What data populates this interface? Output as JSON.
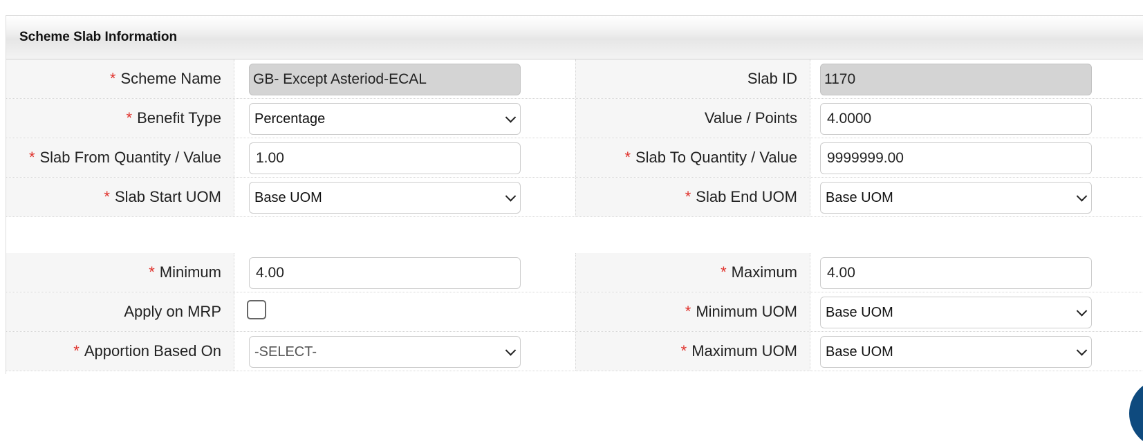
{
  "panel": {
    "title": "Scheme Slab Information"
  },
  "section1": {
    "rows": [
      {
        "left": {
          "label": "Scheme Name",
          "required": true,
          "type": "readonly",
          "value": "GB- Except Asteriod-ECAL"
        },
        "right": {
          "label": "Slab ID",
          "required": false,
          "type": "readonly",
          "value": "1170"
        }
      },
      {
        "left": {
          "label": "Benefit Type",
          "required": true,
          "type": "select",
          "value": "Percentage"
        },
        "right": {
          "label": "Value / Points",
          "required": false,
          "type": "input",
          "value": "4.0000"
        }
      },
      {
        "left": {
          "label": "Slab From Quantity / Value",
          "required": true,
          "type": "input",
          "value": "1.00"
        },
        "right": {
          "label": "Slab To Quantity / Value",
          "required": true,
          "type": "input",
          "value": "9999999.00"
        }
      },
      {
        "left": {
          "label": "Slab Start UOM",
          "required": true,
          "type": "select",
          "value": "Base UOM"
        },
        "right": {
          "label": "Slab End UOM",
          "required": true,
          "type": "select",
          "value": "Base UOM"
        }
      }
    ]
  },
  "section2": {
    "rows": [
      {
        "left": {
          "label": "Minimum",
          "required": true,
          "type": "input",
          "value": "4.00"
        },
        "right": {
          "label": "Maximum",
          "required": true,
          "type": "input",
          "value": "4.00"
        }
      },
      {
        "left": {
          "label": "Apply on MRP",
          "required": false,
          "type": "checkbox",
          "checked": false
        },
        "right": {
          "label": "Minimum UOM",
          "required": true,
          "type": "select",
          "value": "Base UOM"
        }
      },
      {
        "left": {
          "label": "Apportion Based On",
          "required": true,
          "type": "select",
          "value": "-SELECT-"
        },
        "right": {
          "label": "Maximum UOM",
          "required": true,
          "type": "select",
          "value": "Base UOM"
        }
      }
    ]
  },
  "required_marker": "*",
  "colors": {
    "required": "#e0312b",
    "readonly_bg": "#d4d4d4",
    "label_bg": "#f6f6f6",
    "accent": "#0e4a7e"
  }
}
